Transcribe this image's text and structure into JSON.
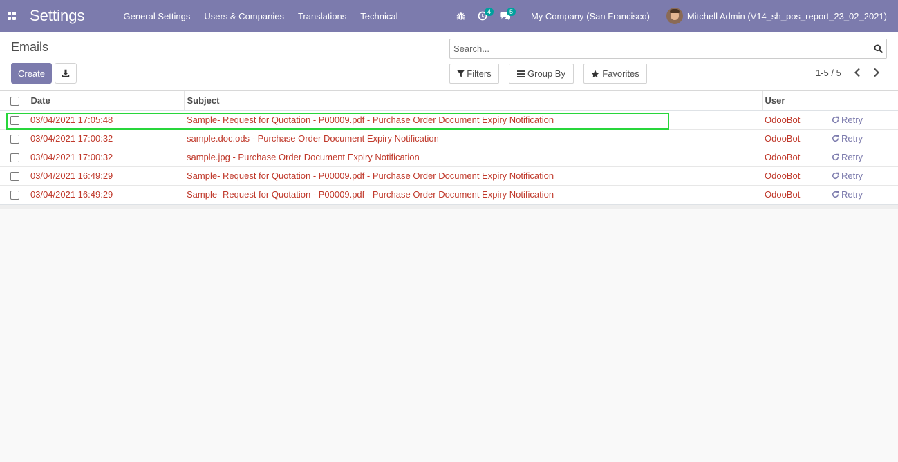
{
  "navbar": {
    "brand": "Settings",
    "menu": [
      "General Settings",
      "Users & Companies",
      "Translations",
      "Technical"
    ],
    "activity_count": "4",
    "messages_count": "5",
    "company": "My Company (San Francisco)",
    "user": "Mitchell Admin (V14_sh_pos_report_23_02_2021)"
  },
  "control_panel": {
    "title": "Emails",
    "create_label": "Create",
    "search_placeholder": "Search...",
    "filters_label": "Filters",
    "groupby_label": "Group By",
    "favorites_label": "Favorites",
    "pager": "1-5 / 5"
  },
  "table": {
    "headers": [
      "Date",
      "Subject",
      "User"
    ],
    "retry_label": "Retry",
    "rows": [
      {
        "date": "03/04/2021 17:05:48",
        "subject": "Sample- Request for Quotation - P00009.pdf - Purchase Order Document Expiry Notification",
        "user": "OdooBot"
      },
      {
        "date": "03/04/2021 17:00:32",
        "subject": "sample.doc.ods - Purchase Order Document Expiry Notification",
        "user": "OdooBot"
      },
      {
        "date": "03/04/2021 17:00:32",
        "subject": "sample.jpg - Purchase Order Document Expiry Notification",
        "user": "OdooBot"
      },
      {
        "date": "03/04/2021 16:49:29",
        "subject": "Sample- Request for Quotation - P00009.pdf - Purchase Order Document Expiry Notification",
        "user": "OdooBot"
      },
      {
        "date": "03/04/2021 16:49:29",
        "subject": "Sample- Request for Quotation - P00009.pdf - Purchase Order Document Expiry Notification",
        "user": "OdooBot"
      }
    ]
  },
  "colors": {
    "navbar": "#7c7bad",
    "row_text": "#c0392b",
    "retry": "#7c7bad",
    "highlight": "#28d63b"
  }
}
